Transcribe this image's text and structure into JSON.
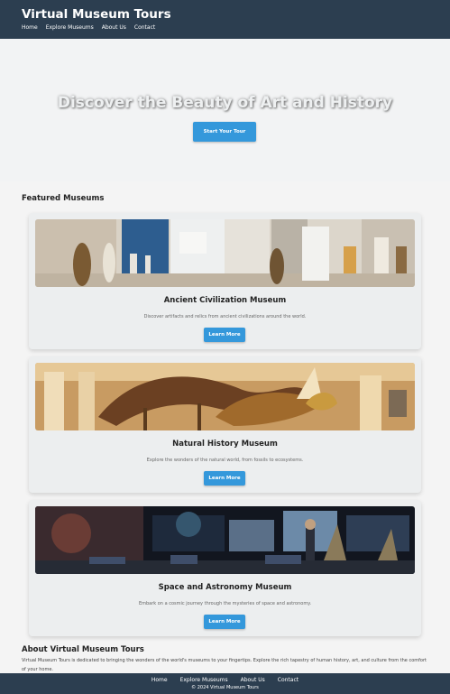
{
  "header": {
    "title": "Virtual Museum Tours",
    "nav": [
      "Home",
      "Explore Museums",
      "About Us",
      "Contact"
    ]
  },
  "hero": {
    "heading": "Discover the Beauty of Art and History",
    "cta": "Start Your Tour"
  },
  "featured": {
    "title": "Featured Museums",
    "museums": [
      {
        "name": "Ancient Civilization Museum",
        "description": "Discover artifacts and relics from ancient civilizations around the world.",
        "button": "Learn More",
        "image": "museum-gallery-image"
      },
      {
        "name": "Natural History Museum",
        "description": "Explore the wonders of the natural world, from fossils to ecosystems.",
        "button": "Learn More",
        "image": "dinosaur-skeleton-image"
      },
      {
        "name": "Space and Astronomy Museum",
        "description": "Embark on a cosmic journey through the mysteries of space and astronomy.",
        "button": "Learn More",
        "image": "planetarium-exhibit-image"
      }
    ]
  },
  "about": {
    "title": "About Virtual Museum Tours",
    "text": "Virtual Museum Tours is dedicated to bringing the wonders of the world's museums to your fingertips. Explore the rich tapestry of human history, art, and culture from the comfort of your home."
  },
  "footer": {
    "nav": [
      "Home",
      "Explore Museums",
      "About Us",
      "Contact"
    ],
    "copyright": "© 2024 Virtual Museum Tours"
  },
  "colors": {
    "header_bg": "#2c3e50",
    "button": "#3498db",
    "page_bg": "#f4f4f4"
  }
}
